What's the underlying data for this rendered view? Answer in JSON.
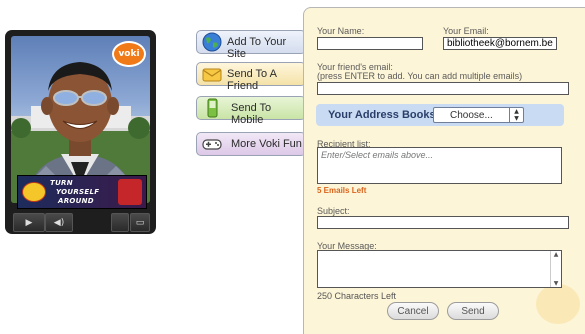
{
  "player": {
    "logo_text": "voki",
    "banner": {
      "line1": "TURN",
      "line2": "YOURSELF",
      "line3": "AROUND"
    }
  },
  "actions": [
    {
      "label": "Add To Your Site",
      "icon": "globe-icon"
    },
    {
      "label": "Send To A Friend",
      "icon": "envelope-icon"
    },
    {
      "label": "Send To Mobile",
      "icon": "mobile-phone-icon"
    },
    {
      "label": "More Voki Fun",
      "icon": "gamepad-icon"
    }
  ],
  "form": {
    "your_name_label": "Your Name:",
    "your_name_value": "",
    "your_email_label": "Your Email:",
    "your_email_value": "bibliotheek@bornem.be",
    "friend_email_label": "Your friend's email:",
    "friend_email_hint": "(press ENTER to add. You can add multiple emails)",
    "friend_email_value": "",
    "address_books_label": "Your Address Books:",
    "address_books_selected": "Choose...",
    "recipient_list_label": "Recipient list:",
    "recipient_list_placeholder": "Enter/Select emails above...",
    "emails_left": "5 Emails Left",
    "subject_label": "Subject:",
    "subject_value": "",
    "message_label": "Your Message:",
    "characters_left": "250 Characters Left",
    "cancel_label": "Cancel",
    "send_label": "Send"
  },
  "colors": {
    "panel_bg": "#fdf5d7",
    "accent_orange": "#d9641c",
    "address_bar": "#c9dbf2"
  }
}
